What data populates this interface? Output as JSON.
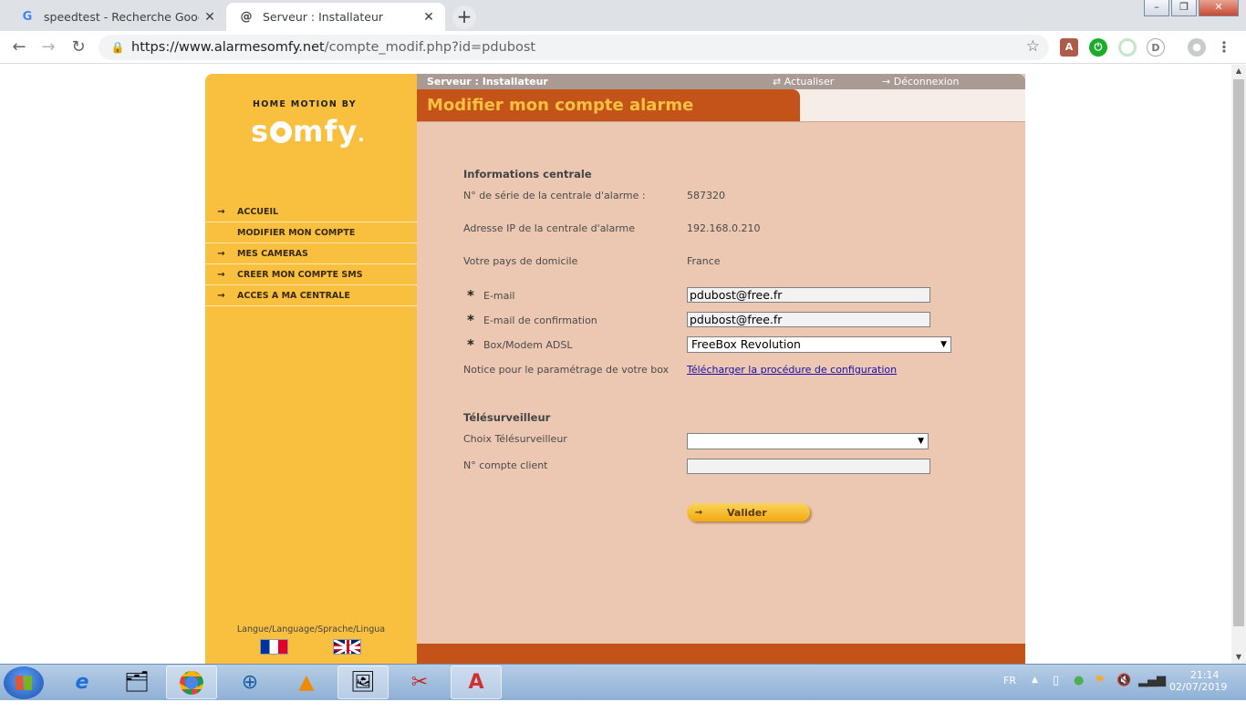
{
  "browser": {
    "tabs": [
      {
        "title": "speedtest - Recherche Google",
        "favicon": "G",
        "active": false
      },
      {
        "title": "Serveur : Installateur",
        "favicon": "@",
        "active": true
      }
    ],
    "url_domain": "https://www.alarmesomfy.net",
    "url_path": "/compte_modif.php?id=pdubost",
    "icons": {
      "back": "back-arrow-icon",
      "forward": "forward-arrow-icon",
      "reload": "reload-icon",
      "lock": "lock-icon",
      "star": "star-icon"
    }
  },
  "sidebar": {
    "logo_top": "HOME MOTION BY",
    "logo_main_left": "s",
    "logo_main_right": "mfy",
    "logo_reg": ".",
    "menu": [
      {
        "label": "ACCUEIL",
        "arrow": "→",
        "active": false
      },
      {
        "label": "MODIFIER MON COMPTE",
        "arrow": "",
        "active": true
      },
      {
        "label": "MES CAMERAS",
        "arrow": "→",
        "active": false
      },
      {
        "label": "CREER MON COMPTE SMS",
        "arrow": "→",
        "active": false
      },
      {
        "label": "ACCES A MA CENTRALE",
        "arrow": "→",
        "active": false
      }
    ],
    "language_label": "Langue/Language/Sprache/Lingua"
  },
  "header": {
    "server_label": "Serveur : Installateur",
    "refresh_label": "Actualiser",
    "logout_label": "Déconnexion",
    "page_title": "Modifier mon compte alarme"
  },
  "form": {
    "central_section": "Informations centrale",
    "serial_label": "N° de série de la centrale d'alarme :",
    "serial_value": "587320",
    "ip_label": "Adresse IP de la centrale d'alarme",
    "ip_value": "192.168.0.210",
    "country_label": "Votre pays de domicile",
    "country_value": "France",
    "required_mark": "*",
    "email_label": "E-mail",
    "email_value": "pdubost@free.fr",
    "email_confirm_label": "E-mail de confirmation",
    "email_confirm_value": "pdubost@free.fr",
    "box_label": "Box/Modem ADSL",
    "box_value": "FreeBox Revolution",
    "notice_label": "Notice pour le paramétrage de votre box",
    "notice_link": "Télécharger la procédure de configuration",
    "remote_section": "Télésurveilleur",
    "remote_choice_label": "Choix Télésurveilleur",
    "remote_choice_value": "",
    "client_account_label": "N° compte client",
    "client_account_value": "",
    "submit_label": "Valider"
  },
  "taskbar": {
    "language": "FR",
    "time": "21:14",
    "date": "02/07/2019"
  }
}
